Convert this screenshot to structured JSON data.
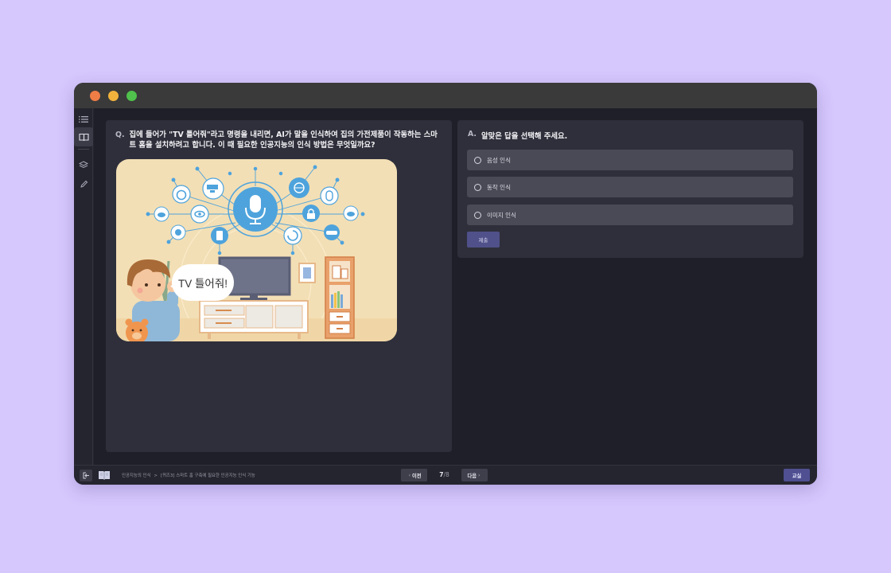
{
  "question": {
    "prefix": "Q.",
    "text": "집에 들어가 \"TV 틀어줘\"라고 명령을 내리면, AI가 말을 인식하여 집의 가전제품이 작동하는 스마트 홈을 설치하려고 합니다. 이 때 필요한 인공지능의 인식 방법은 무엇일까요?",
    "illustration": {
      "speech_bubble": "TV 틀어줘!",
      "icons": [
        "microphone-icon",
        "cctv-icon",
        "alarm-clock-icon",
        "cloud-icon",
        "eye-icon",
        "speaker-icon",
        "smartphone-icon",
        "globe-icon",
        "mouse-icon",
        "lock-icon",
        "refresh-icon",
        "car-icon"
      ]
    }
  },
  "answer": {
    "prefix": "A.",
    "header": "알맞은 답을 선택해 주세요.",
    "options": [
      {
        "label": "음성 인식"
      },
      {
        "label": "동작 인식"
      },
      {
        "label": "이미지 인식"
      }
    ],
    "submit_label": "제출"
  },
  "bottom": {
    "breadcrumb": [
      "인공지능의 인식",
      "[퀴즈3] 스마트 홈 구축에 필요한 인공지능 인식 기능"
    ],
    "breadcrumb_separator": ">",
    "prev_label": "이전",
    "next_label": "다음",
    "page_current": "7",
    "page_total": "/8",
    "classroom_label": "교실"
  },
  "sidebar": {
    "icons": [
      "list-icon",
      "book-open-icon",
      "layers-icon",
      "pencil-icon"
    ],
    "active": "book-open-icon"
  },
  "colors": {
    "background": "#d6c8fd",
    "window": "#25252f",
    "panel": "#2f2f3b",
    "option": "#4a4a57",
    "accent": "#50508a",
    "illustration_bg": "#f3dfb5",
    "icon_blue": "#4ea3dc"
  }
}
